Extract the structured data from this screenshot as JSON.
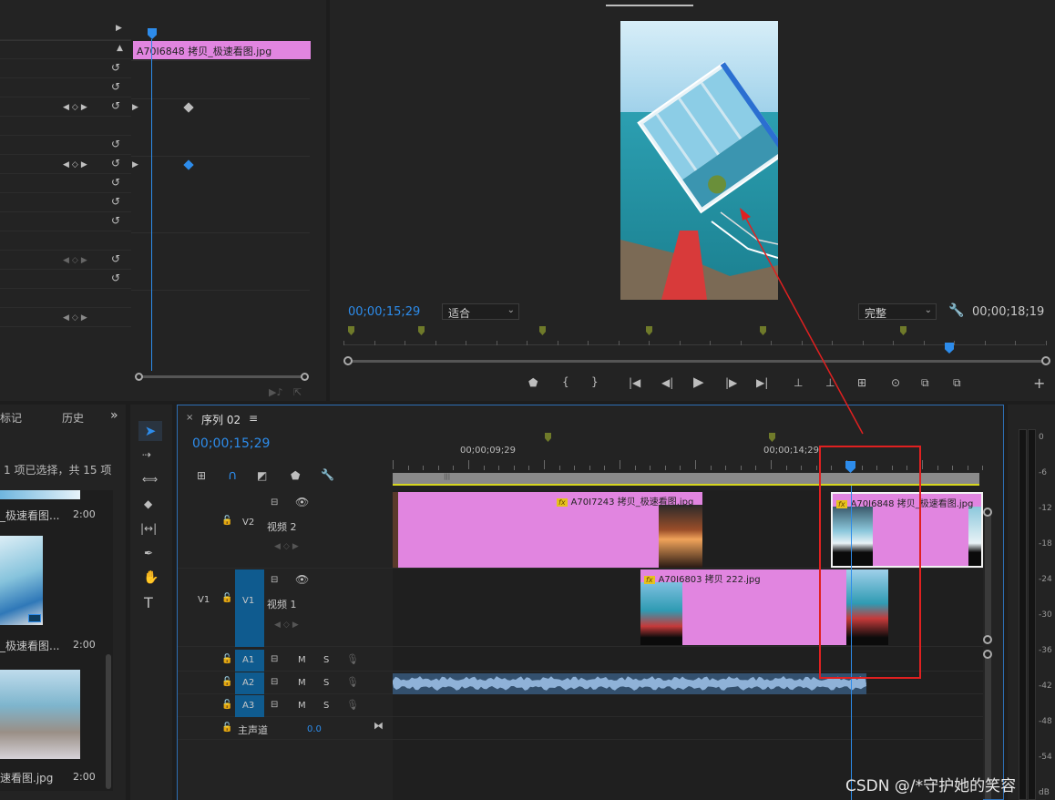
{
  "effect_controls": {
    "clip_label": "A70I6848 拷贝_极速看图.jpg"
  },
  "program_monitor": {
    "current_time": "00;00;15;29",
    "fit_select": "适合",
    "quality_select": "完整",
    "duration": "00;00;18;19"
  },
  "project_panel": {
    "tab_markers": "标记",
    "tab_history": "历史",
    "selection_info": "1 项已选择，共 15 项",
    "items": [
      {
        "name": "_极速看图...",
        "duration": "2:00"
      },
      {
        "name": "_极速看图...",
        "duration": "2:00"
      },
      {
        "name": "速看图.jpg",
        "duration": "2:00"
      }
    ]
  },
  "timeline": {
    "close": "×",
    "sequence_name": "序列 02",
    "menu": "≡",
    "current_time": "00;00;15;29",
    "ruler_labels": [
      "00;00;09;29",
      "00;00;14;29"
    ],
    "tracks": {
      "v2": {
        "toggle": "V2",
        "name": "视频 2"
      },
      "v1": {
        "source": "V1",
        "toggle": "V1",
        "name": "视频 1"
      },
      "a1": {
        "toggle": "A1",
        "m": "M",
        "s": "S"
      },
      "a2": {
        "toggle": "A2",
        "m": "M",
        "s": "S"
      },
      "a3": {
        "toggle": "A3",
        "m": "M",
        "s": "S"
      },
      "master": {
        "name": "主声道",
        "value": "0.0"
      }
    },
    "clips": {
      "v2_clip1": "A70I7243 拷贝_极速看图.jpg",
      "v2_clip2": "A70I6848 拷贝_极速看图.jpg",
      "v1_clip1": "A70I6803 拷贝 222.jpg"
    },
    "fx_badge": "fx"
  },
  "audio_meter": {
    "scale": [
      "0",
      "-6",
      "-12",
      "-18",
      "-24",
      "-30",
      "-36",
      "-42",
      "-48",
      "-54"
    ],
    "unit": "dB"
  },
  "watermark": "CSDN @/*守护她的笑容",
  "colors": {
    "accent_blue": "#2d8ceb",
    "clip_pink": "#e185e0",
    "annotation_red": "#e02020",
    "track_active": "#0f5b8f"
  }
}
